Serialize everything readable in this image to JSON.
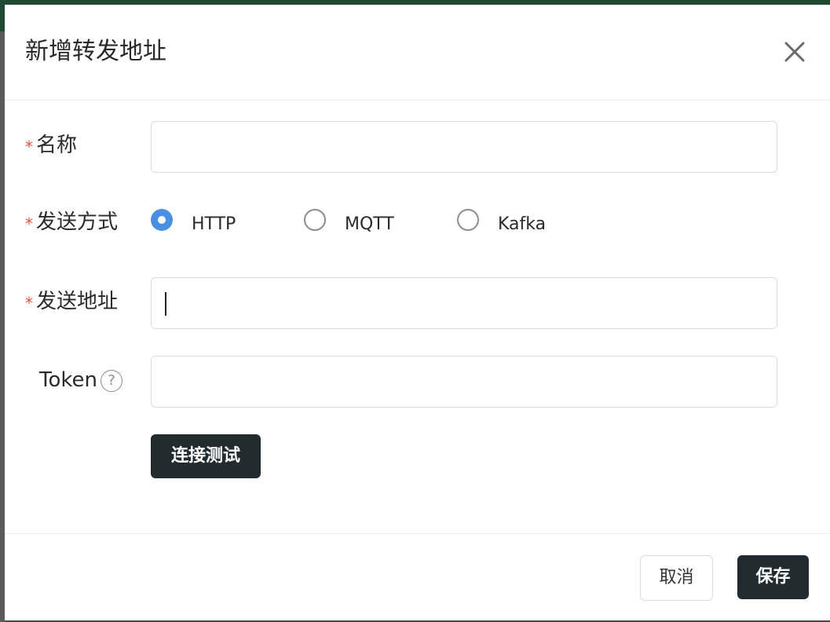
{
  "dialog": {
    "title": "新增转发地址",
    "close_icon": "close-icon"
  },
  "form": {
    "name": {
      "required_mark": "*",
      "label": "名称",
      "value": "",
      "placeholder": ""
    },
    "method": {
      "required_mark": "*",
      "label": "发送方式",
      "options": [
        {
          "label": "HTTP",
          "checked": true
        },
        {
          "label": "MQTT",
          "checked": false
        },
        {
          "label": "Kafka",
          "checked": false
        }
      ]
    },
    "address": {
      "required_mark": "*",
      "label": "发送地址",
      "value": "",
      "placeholder": ""
    },
    "token": {
      "label": "Token",
      "help_glyph": "?",
      "value": "",
      "placeholder": ""
    },
    "test_button": "连接测试"
  },
  "footer": {
    "cancel_label": "取消",
    "save_label": "保存"
  },
  "colors": {
    "required": "#e1523d",
    "radio_checked": "#4a90e2",
    "dark_button": "#222b30",
    "top_bar": "#1f4a31"
  }
}
